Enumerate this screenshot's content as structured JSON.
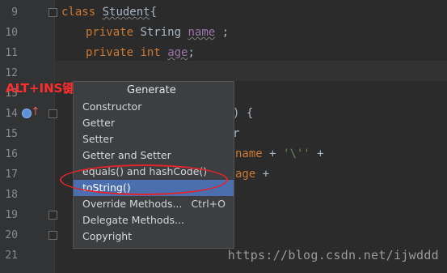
{
  "line_numbers": [
    "9",
    "10",
    "11",
    "12",
    "13",
    "14",
    "15",
    "16",
    "17",
    "18",
    "19",
    "20",
    "21"
  ],
  "code": {
    "l9": {
      "kw": "class",
      "name": "Student",
      "rest": "{"
    },
    "l10": {
      "kw": "private",
      "type": "String",
      "name": "name",
      "rest": " ;"
    },
    "l11": {
      "kw": "private",
      "type": "int",
      "name": "age",
      "rest": ";"
    },
    "l14_rest": ") {",
    "l15_rest": "r",
    "l16_name": "name",
    "l16_plus1": " + ",
    "l16_str": "'\\''",
    "l16_plus2": " +",
    "l17_name": "age",
    "l17_plus": " +"
  },
  "annotation": "ALT+INS键打开",
  "menu": {
    "title": "Generate",
    "items": [
      {
        "label": "Constructor",
        "shortcut": ""
      },
      {
        "label": "Getter",
        "shortcut": ""
      },
      {
        "label": "Setter",
        "shortcut": ""
      },
      {
        "label": "Getter and Setter",
        "shortcut": ""
      },
      {
        "label": "equals() and hashCode()",
        "shortcut": ""
      },
      {
        "label": "toString()",
        "shortcut": ""
      },
      {
        "label": "Override Methods...",
        "shortcut": "Ctrl+O"
      },
      {
        "label": "Delegate Methods...",
        "shortcut": ""
      },
      {
        "label": "Copyright",
        "shortcut": ""
      }
    ],
    "selected_index": 5
  },
  "watermark": "https://blog.csdn.net/ijwddd",
  "colors": {
    "background": "#2b2b2b",
    "keyword": "#cc7832",
    "selection": "#4b6eaf",
    "highlight": "#e0242a"
  }
}
